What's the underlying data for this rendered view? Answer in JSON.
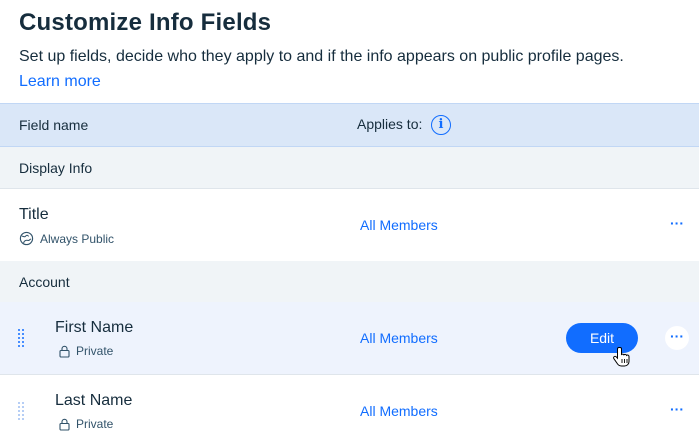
{
  "header": {
    "title": "Customize Info Fields",
    "subtitle": "Set up fields, decide who they apply to and if the info appears on public profile pages.",
    "learn_more": "Learn more"
  },
  "table": {
    "col_field_name": "Field name",
    "col_applies_to": "Applies to:",
    "info_icon": "i"
  },
  "sections": [
    {
      "label": "Display Info",
      "rows": [
        {
          "name": "Title",
          "visibility": "Always Public",
          "visibility_icon": "globe-icon",
          "applies_to": "All Members",
          "more": "···"
        }
      ]
    },
    {
      "label": "Account",
      "rows": [
        {
          "name": "First Name",
          "visibility": "Private",
          "visibility_icon": "lock-icon",
          "applies_to": "All Members",
          "more": "···",
          "edit_label": "Edit"
        },
        {
          "name": "Last Name",
          "visibility": "Private",
          "visibility_icon": "lock-icon",
          "applies_to": "All Members",
          "more": "···"
        }
      ]
    }
  ],
  "colors": {
    "accent": "#116dff",
    "header_bg": "#dae7f8",
    "section_bg": "#f0f4f7",
    "hover_bg": "#eef3fd",
    "text": "#162d3d"
  }
}
